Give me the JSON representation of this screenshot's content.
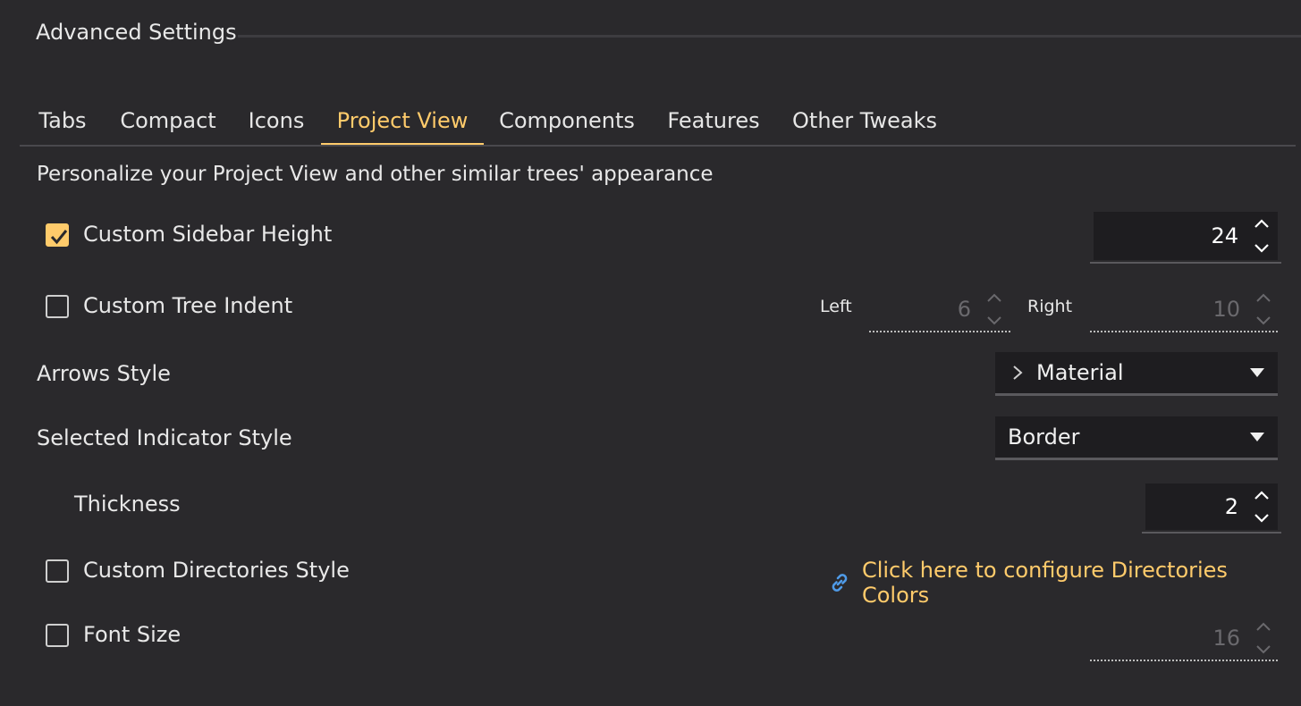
{
  "section": {
    "title": "Advanced Settings"
  },
  "tabs": [
    {
      "label": "Tabs"
    },
    {
      "label": "Compact"
    },
    {
      "label": "Icons"
    },
    {
      "label": "Project View",
      "active": true
    },
    {
      "label": "Components"
    },
    {
      "label": "Features"
    },
    {
      "label": "Other Tweaks"
    }
  ],
  "description": "Personalize your Project View and other similar trees' appearance",
  "options": {
    "sidebar_height": {
      "label": "Custom Sidebar Height",
      "checked": true,
      "value": "24"
    },
    "tree_indent": {
      "label": "Custom Tree Indent",
      "checked": false,
      "left_label": "Left",
      "left_value": "6",
      "right_label": "Right",
      "right_value": "10"
    },
    "arrows_style": {
      "label": "Arrows Style",
      "selected": "Material",
      "icon": "chevron-right-icon"
    },
    "indicator_style": {
      "label": "Selected Indicator Style",
      "selected": "Border"
    },
    "thickness": {
      "label": "Thickness",
      "value": "2"
    },
    "directories_style": {
      "label": "Custom Directories Style",
      "checked": false,
      "link_text": "Click here to configure Directories Colors",
      "link_icon": "link-icon"
    },
    "font_size": {
      "label": "Font Size",
      "checked": false,
      "value": "16"
    }
  },
  "colors": {
    "background": "#2a292c",
    "accent": "#ffcb6b",
    "field": "#1e1d20",
    "link_icon": "#4f9be8"
  }
}
